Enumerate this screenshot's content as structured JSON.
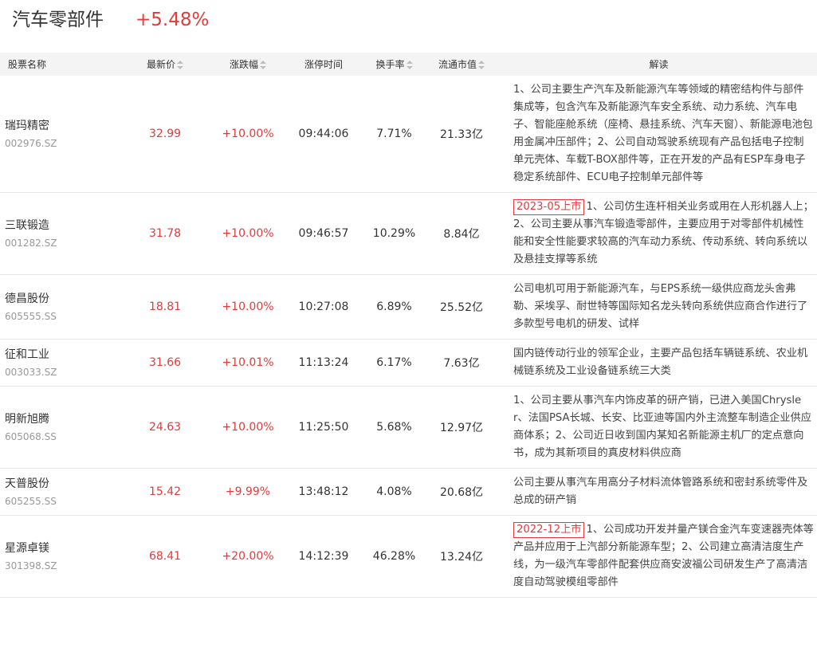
{
  "sector": {
    "title": "汽车零部件",
    "change": "+5.48%"
  },
  "columns": {
    "name": "股票名称",
    "price": "最新价",
    "change": "涨跌幅",
    "limit_time": "涨停时间",
    "turnover": "换手率",
    "market_cap": "流通市值",
    "desc": "解读"
  },
  "rows": [
    {
      "name": "瑞玛精密",
      "code": "002976.SZ",
      "price": "32.99",
      "change": "+10.00%",
      "time": "09:44:06",
      "turnover": "7.71%",
      "cap": "21.33亿",
      "tag": "",
      "desc": "1、公司主要生产汽车及新能源汽车等领域的精密结构件与部件集成等，包含汽车及新能源汽车安全系统、动力系统、汽车电子、智能座舱系统（座椅、悬挂系统、汽车天窗）、新能源电池包用金属冲压部件；2、公司自动驾驶系统现有产品包括电子控制单元壳体、车载T-BOX部件等，正在开发的产品有ESP车身电子稳定系统部件、ECU电子控制单元部件等"
    },
    {
      "name": "三联锻造",
      "code": "001282.SZ",
      "price": "31.78",
      "change": "+10.00%",
      "time": "09:46:57",
      "turnover": "10.29%",
      "cap": "8.84亿",
      "tag": "2023-05上市",
      "desc": "1、公司仿生连杆相关业务或用在人形机器人上；2、公司主要从事汽车锻造零部件，主要应用于对零部件机械性能和安全性能要求较高的汽车动力系统、传动系统、转向系统以及悬挂支撑等系统"
    },
    {
      "name": "德昌股份",
      "code": "605555.SS",
      "price": "18.81",
      "change": "+10.00%",
      "time": "10:27:08",
      "turnover": "6.89%",
      "cap": "25.52亿",
      "tag": "",
      "desc": "公司电机可用于新能源汽车，与EPS系统一级供应商龙头舍弗勒、采埃孚、耐世特等国际知名龙头转向系统供应商合作进行了多款型号电机的研发、试样"
    },
    {
      "name": "征和工业",
      "code": "003033.SZ",
      "price": "31.66",
      "change": "+10.01%",
      "time": "11:13:24",
      "turnover": "6.17%",
      "cap": "7.63亿",
      "tag": "",
      "desc": "国内链传动行业的领军企业，主要产品包括车辆链系统、农业机械链系统及工业设备链系统三大类"
    },
    {
      "name": "明新旭腾",
      "code": "605068.SS",
      "price": "24.63",
      "change": "+10.00%",
      "time": "11:25:50",
      "turnover": "5.68%",
      "cap": "12.97亿",
      "tag": "",
      "desc": "1、公司主要从事汽车内饰皮革的研产销，已进入美国Chrysler、法国PSA长城、长安、比亚迪等国内外主流整车制造企业供应商体系；2、公司近日收到国内某知名新能源主机厂的定点意向书，成为其新项目的真皮材料供应商"
    },
    {
      "name": "天普股份",
      "code": "605255.SS",
      "price": "15.42",
      "change": "+9.99%",
      "time": "13:48:12",
      "turnover": "4.08%",
      "cap": "20.68亿",
      "tag": "",
      "desc": "公司主要从事汽车用高分子材料流体管路系统和密封系统零件及总成的研产销"
    },
    {
      "name": "星源卓镁",
      "code": "301398.SZ",
      "price": "68.41",
      "change": "+20.00%",
      "time": "14:12:39",
      "turnover": "46.28%",
      "cap": "13.24亿",
      "tag": "2022-12上市",
      "desc": "1、公司成功开发并量产镁合金汽车变速器壳体等产品并应用于上汽部分新能源车型；2、公司建立高清洁度生产线，为一级汽车零部件配套供应商安波福公司研发生产了高清洁度自动驾驶模组零部件"
    }
  ]
}
